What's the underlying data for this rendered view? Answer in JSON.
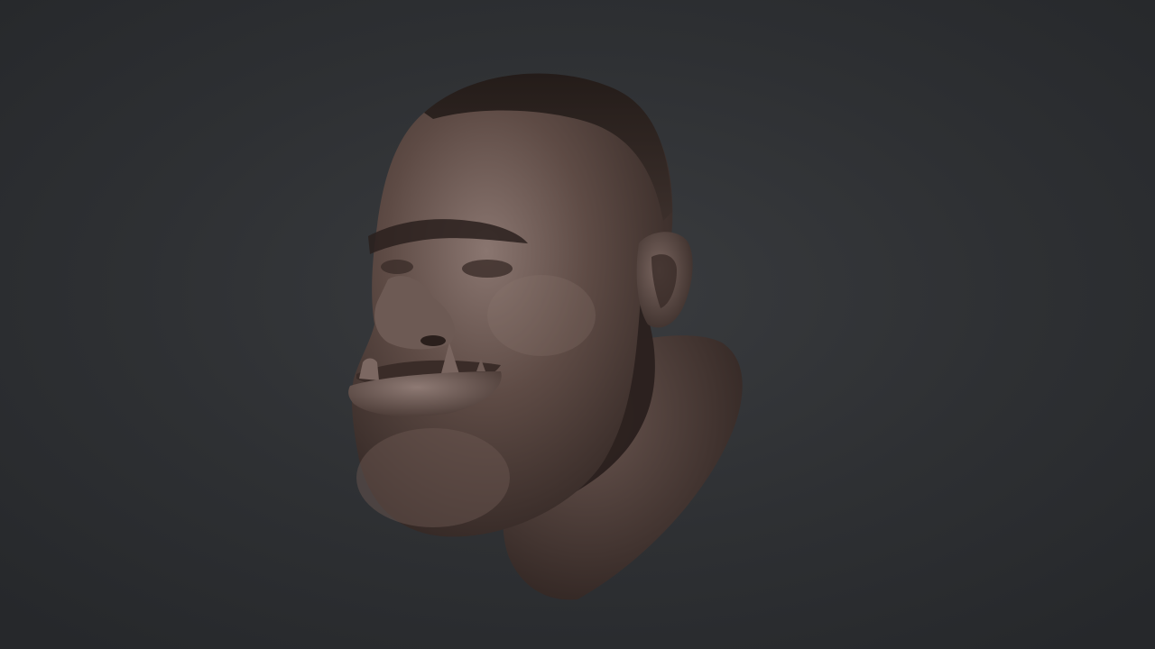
{
  "scene": {
    "subject_icon": "sculpted-orc-head-icon",
    "colors": {
      "background": "#2e3033",
      "clay_mid": "#5e4b45",
      "clay_light": "#8a7670",
      "clay_dark": "#3a2c28",
      "hair": "#1f1815"
    }
  }
}
